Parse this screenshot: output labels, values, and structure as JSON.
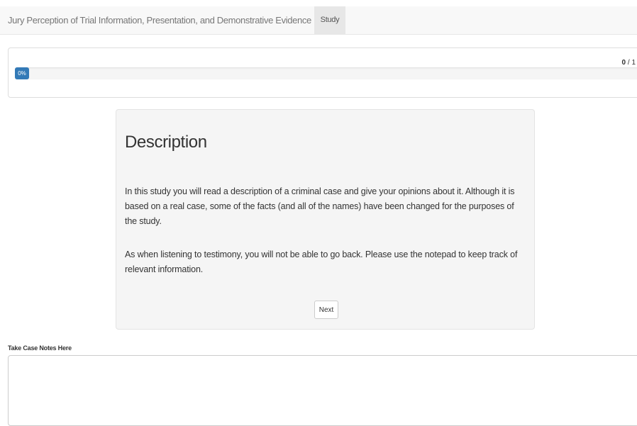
{
  "navbar": {
    "brand": "Jury Perception of Trial Information, Presentation, and Demonstrative Evidence",
    "tab_label": "Study"
  },
  "progress": {
    "current": "0",
    "total": "1",
    "separator": " / ",
    "percent_label": "0%",
    "percent_value": 0
  },
  "card": {
    "title": "Description",
    "paragraph_1": "In this study you will read a description of a criminal case and give your opinions about it. Although it is based on a real case, some of the facts (and all of the names) have been changed for the purposes of the study.",
    "paragraph_2": "As when listening to testimony, you will not be able to go back. Please use the notepad to keep track of relevant information.",
    "next_label": "Next"
  },
  "notes": {
    "label": "Take Case Notes Here",
    "value": "",
    "placeholder": ""
  },
  "colors": {
    "accent": "#337ab7",
    "navbar_bg": "#f8f8f8",
    "card_bg": "#f5f5f5"
  }
}
